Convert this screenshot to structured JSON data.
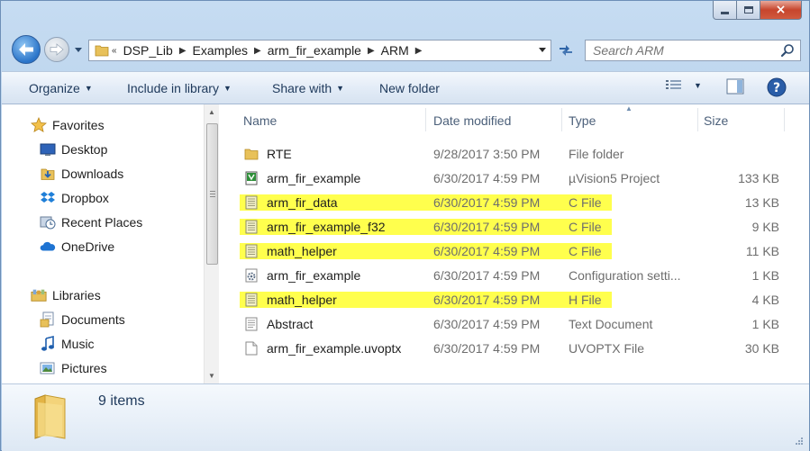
{
  "window": {
    "buttons": {
      "minimize": "minimize",
      "maximize": "maximize",
      "close": "×"
    }
  },
  "address_bar": {
    "overflow": "«",
    "breadcrumbs": [
      "DSP_Lib",
      "Examples",
      "arm_fir_example",
      "ARM"
    ]
  },
  "search": {
    "placeholder": "Search ARM"
  },
  "toolbar": {
    "organize": "Organize",
    "include_in_library": "Include in library",
    "share_with": "Share with",
    "new_folder": "New folder"
  },
  "nav_pane": {
    "favorites_header": "Favorites",
    "favorites": [
      {
        "label": "Desktop",
        "icon": "desktop-icon"
      },
      {
        "label": "Downloads",
        "icon": "downloads-icon"
      },
      {
        "label": "Dropbox",
        "icon": "dropbox-icon"
      },
      {
        "label": "Recent Places",
        "icon": "recent-places-icon"
      },
      {
        "label": "OneDrive",
        "icon": "onedrive-icon"
      }
    ],
    "libraries_header": "Libraries",
    "libraries": [
      {
        "label": "Documents",
        "icon": "documents-icon"
      },
      {
        "label": "Music",
        "icon": "music-icon"
      },
      {
        "label": "Pictures",
        "icon": "pictures-icon"
      }
    ]
  },
  "columns": {
    "name": "Name",
    "date": "Date modified",
    "type": "Type",
    "size": "Size"
  },
  "files": [
    {
      "name": "RTE",
      "date": "9/28/2017 3:50 PM",
      "type": "File folder",
      "size": "",
      "icon": "folder-icon",
      "highlighted": false
    },
    {
      "name": "arm_fir_example",
      "date": "6/30/2017 4:59 PM",
      "type": "µVision5 Project",
      "size": "133 KB",
      "icon": "uvision-project-icon",
      "highlighted": false
    },
    {
      "name": "arm_fir_data",
      "date": "6/30/2017 4:59 PM",
      "type": "C File",
      "size": "13 KB",
      "icon": "c-file-icon",
      "highlighted": true
    },
    {
      "name": "arm_fir_example_f32",
      "date": "6/30/2017 4:59 PM",
      "type": "C File",
      "size": "9 KB",
      "icon": "c-file-icon",
      "highlighted": true
    },
    {
      "name": "math_helper",
      "date": "6/30/2017 4:59 PM",
      "type": "C File",
      "size": "11 KB",
      "icon": "c-file-icon",
      "highlighted": true
    },
    {
      "name": "arm_fir_example",
      "date": "6/30/2017 4:59 PM",
      "type": "Configuration setti...",
      "size": "1 KB",
      "icon": "config-file-icon",
      "highlighted": false
    },
    {
      "name": "math_helper",
      "date": "6/30/2017 4:59 PM",
      "type": "H File",
      "size": "4 KB",
      "icon": "h-file-icon",
      "highlighted": true
    },
    {
      "name": "Abstract",
      "date": "6/30/2017 4:59 PM",
      "type": "Text Document",
      "size": "1 KB",
      "icon": "text-file-icon",
      "highlighted": false
    },
    {
      "name": "arm_fir_example.uvoptx",
      "date": "6/30/2017 4:59 PM",
      "type": "UVOPTX File",
      "size": "30 KB",
      "icon": "generic-file-icon",
      "highlighted": false
    }
  ],
  "details_pane": {
    "item_count": "9 items"
  },
  "colors": {
    "highlight": "#ffff4d",
    "toolbar_text": "#1e395b",
    "secondary_text": "#6d6d6d"
  }
}
